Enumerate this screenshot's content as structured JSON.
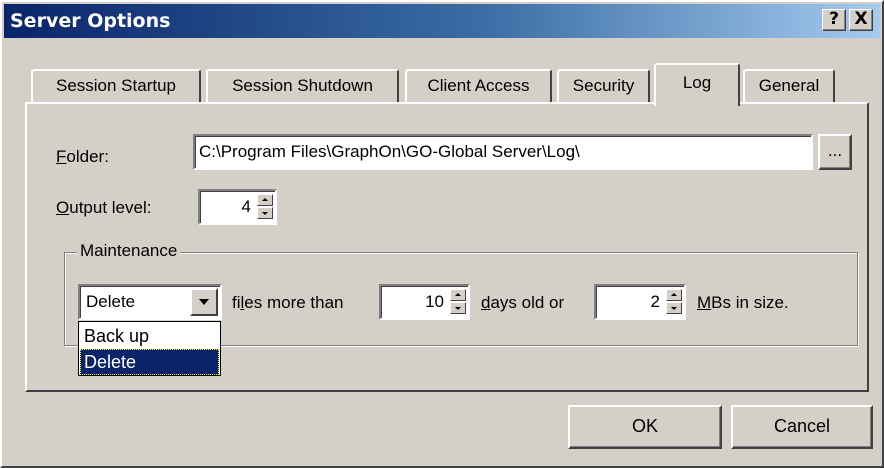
{
  "window": {
    "title": "Server Options",
    "help_label": "?",
    "close_label": "X"
  },
  "tabs": [
    {
      "label": "Session Startup",
      "active": false
    },
    {
      "label": "Session Shutdown",
      "active": false
    },
    {
      "label": "Client Access",
      "active": false
    },
    {
      "label": "Security",
      "active": false
    },
    {
      "label": "Log",
      "active": true
    },
    {
      "label": "General",
      "active": false
    }
  ],
  "log": {
    "folder": {
      "label_accel": "F",
      "label_rest": "older:",
      "value": "C:\\Program Files\\GraphOn\\GO-Global Server\\Log\\",
      "browse_label": "..."
    },
    "output_level": {
      "label_accel": "O",
      "label_rest": "utput level:",
      "value": "4"
    },
    "maintenance": {
      "legend": "Maintenance",
      "action": {
        "selected": "Delete",
        "options": [
          "Back up",
          "Delete"
        ]
      },
      "files_pre": "fi",
      "files_accel": "l",
      "files_post": "es more than",
      "days_value": "10",
      "days_accel": "d",
      "days_rest": "ays old or",
      "mb_value": "2",
      "mb_accel": "M",
      "mb_rest": "Bs in size."
    }
  },
  "buttons": {
    "ok": "OK",
    "cancel": "Cancel"
  },
  "colors": {
    "title_start": "#0a246a",
    "title_end": "#a6caf0",
    "face": "#d4d0c8",
    "selection": "#0a246a"
  }
}
